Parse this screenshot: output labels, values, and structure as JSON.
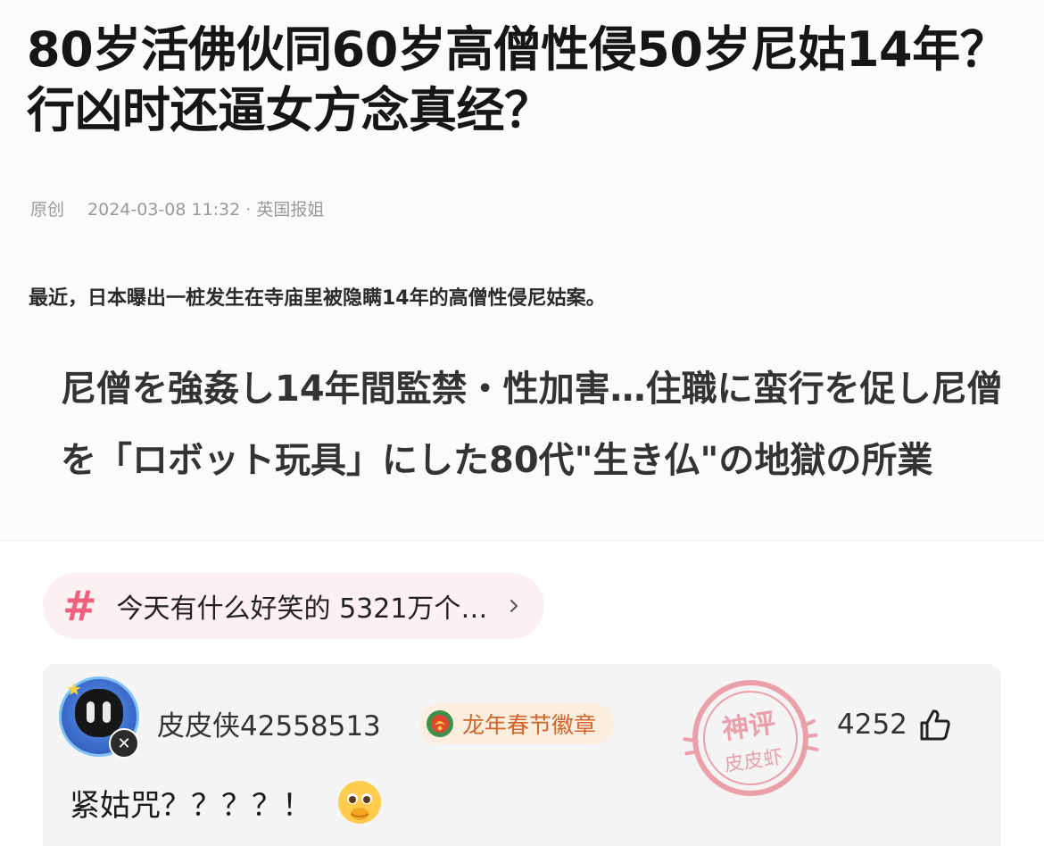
{
  "article": {
    "headline": "80岁活佛伙同60岁高僧性侵50岁尼姑14年？行凶时还逼女方念真经？",
    "meta_tag": "原创",
    "meta_date": "2024-03-08 11:32 · 英国报姐",
    "summary": "最近，日本曝出一桩发生在寺庙里被隐瞒14年的高僧性侵尼姑案。",
    "jp_title": "尼僧を強姦し14年間監禁・性加害…住職に蛮行を促し尼僧を「ロボット玩具」にした80代\"生き仏\"の地獄の所業"
  },
  "topic": {
    "icon": "hash-icon",
    "text": "今天有什么好笑的  5321万个…"
  },
  "comment": {
    "avatar_icon": "avatar-icon",
    "username": "皮皮侠42558513",
    "badge_label": "龙年春节徽章",
    "stamp_top": "神评",
    "stamp_bottom": "皮皮虾",
    "like_count": "4252",
    "text": "紧姑咒？？？？！",
    "emoji": "pleading-face-emoji",
    "colors": {
      "accent_pink": "#f0607c",
      "badge_orange": "#d2642a",
      "stamp_red": "#e0394f"
    }
  }
}
